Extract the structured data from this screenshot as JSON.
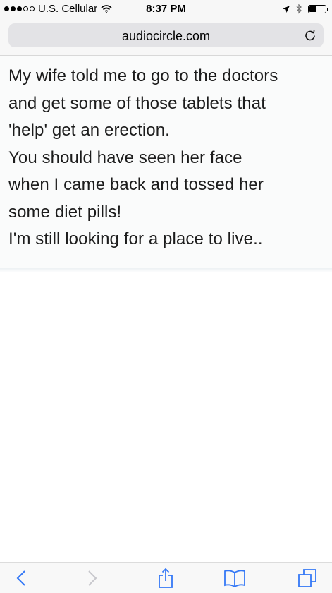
{
  "status_bar": {
    "carrier": "U.S. Cellular",
    "time": "8:37 PM",
    "signal_bars_filled": 3,
    "signal_bars_total": 5,
    "battery_level": 0.45
  },
  "address_bar": {
    "url": "audiocircle.com",
    "reload_icon": "reload-icon"
  },
  "content": {
    "lines": [
      "My wife told me to go to the doctors",
      "and get some of those tablets that",
      "'help' get an erection.",
      "You should have seen her face",
      "when I came back and tossed her",
      "some diet pills!",
      "I'm still looking for a place to live.."
    ]
  },
  "toolbar": {
    "back_icon": "chevron-left-icon",
    "forward_icon": "chevron-right-icon",
    "share_icon": "share-icon",
    "bookmarks_icon": "book-icon",
    "tabs_icon": "tabs-icon"
  },
  "colors": {
    "accent": "#3478f6",
    "disabled": "#c7c7cc"
  }
}
